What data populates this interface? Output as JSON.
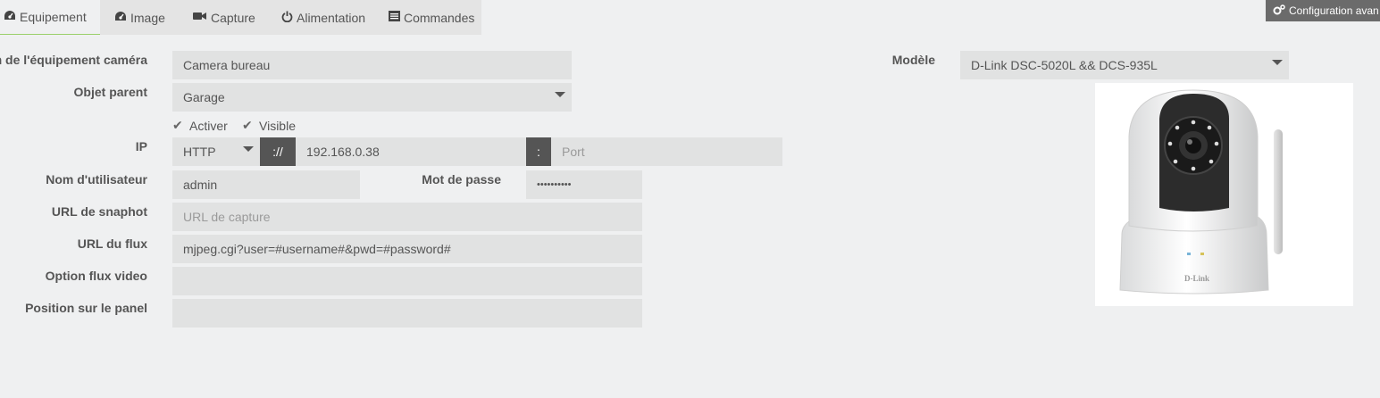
{
  "tabs": [
    {
      "label": "Equipement",
      "icon": "dashboard-icon",
      "active": true
    },
    {
      "label": "Image",
      "icon": "dashboard-icon"
    },
    {
      "label": "Capture",
      "icon": "video-camera-icon"
    },
    {
      "label": "Alimentation",
      "icon": "power-icon"
    },
    {
      "label": "Commandes",
      "icon": "list-icon"
    }
  ],
  "advanced_button": {
    "label": "Configuration avan",
    "icon": "cogs-icon"
  },
  "form": {
    "name": {
      "label": "m de l'équipement caméra",
      "value": "Camera bureau"
    },
    "parent": {
      "label": "Objet parent",
      "value": "Garage"
    },
    "activer": {
      "label": "Activer",
      "checked": true
    },
    "visible": {
      "label": "Visible",
      "checked": true
    },
    "ip": {
      "label": "IP",
      "protocol": "HTTP",
      "separator": "://",
      "address": "192.168.0.38",
      "port_separator": ":",
      "port_placeholder": "Port"
    },
    "username": {
      "label": "Nom d'utilisateur",
      "value": "admin"
    },
    "password": {
      "label": "Mot de passe",
      "value": "••••••••••"
    },
    "snapshot": {
      "label": "URL de snaphot",
      "placeholder": "URL de capture"
    },
    "stream": {
      "label": "URL du flux",
      "value": "mjpeg.cgi?user=#username#&pwd=#password#"
    },
    "stream_option": {
      "label": "Option flux video",
      "value": ""
    },
    "panel_position": {
      "label": "Position sur le panel",
      "value": ""
    }
  },
  "model": {
    "label": "Modèle",
    "value": "D-Link DSC-5020L && DCS-935L",
    "image_brand_text": "D-Link"
  }
}
